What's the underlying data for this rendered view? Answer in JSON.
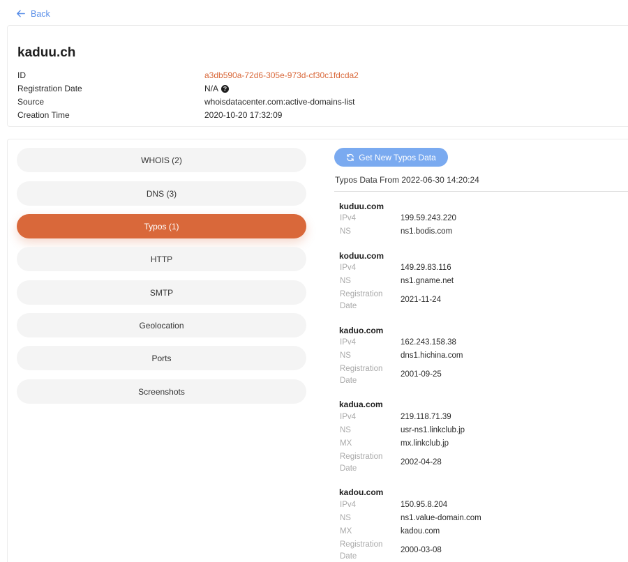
{
  "back_label": "Back",
  "domain": {
    "title": "kaduu.ch",
    "fields": [
      {
        "key": "ID",
        "value": "a3db590a-72d6-305e-973d-cf30c1fdcda2"
      },
      {
        "key": "Registration Date",
        "value": "N/A"
      },
      {
        "key": "Source",
        "value": "whoisdatacenter.com:active-domains-list"
      },
      {
        "key": "Creation Time",
        "value": "2020-10-20 17:32:09"
      }
    ]
  },
  "tabs": [
    {
      "label": "WHOIS (2)"
    },
    {
      "label": "DNS (3)"
    },
    {
      "label": "Typos (1)"
    },
    {
      "label": "HTTP"
    },
    {
      "label": "SMTP"
    },
    {
      "label": "Geolocation"
    },
    {
      "label": "Ports"
    },
    {
      "label": "Screenshots"
    }
  ],
  "active_tab": "Typos (1)",
  "typos": {
    "button_label": "Get New Typos Data",
    "data_date": "Typos Data From 2022-06-30 14:20:24",
    "label_ipv4": "IPv4",
    "label_ns": "NS",
    "label_mx": "MX",
    "label_reg_line1": "Registration",
    "label_reg_line2": "Date",
    "entries": [
      {
        "name": "kuduu.com",
        "ipv4": "199.59.243.220",
        "ns": "ns1.bodis.com"
      },
      {
        "name": "koduu.com",
        "ipv4": "149.29.83.116",
        "ns": "ns1.gname.net",
        "reg_date": "2021-11-24"
      },
      {
        "name": "kaduo.com",
        "ipv4": "162.243.158.38",
        "ns": "dns1.hichina.com",
        "reg_date": "2001-09-25"
      },
      {
        "name": "kadua.com",
        "ipv4": "219.118.71.39",
        "ns": "usr-ns1.linkclub.jp",
        "mx": "mx.linkclub.jp",
        "reg_date": "2002-04-28"
      },
      {
        "name": "kadou.com",
        "ipv4": "150.95.8.204",
        "ns": "ns1.value-domain.com",
        "mx": "kadou.com",
        "reg_date": "2000-03-08"
      }
    ]
  },
  "colors": {
    "accent": "#d9683a",
    "link": "#5a8fe8",
    "button": "#7aaaf0"
  }
}
